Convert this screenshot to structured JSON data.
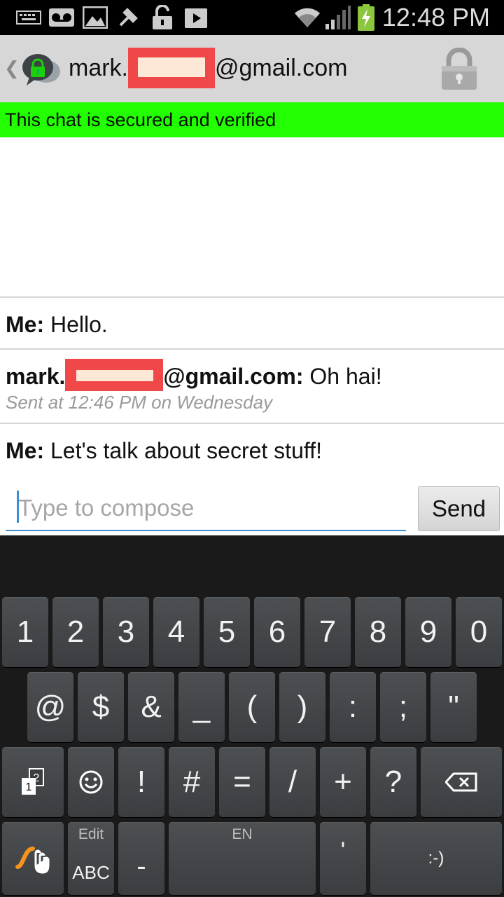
{
  "status_bar": {
    "time": "12:48 PM",
    "icons": [
      "keyboard-icon",
      "voicemail-icon",
      "image-icon",
      "tools-icon",
      "unlock-icon",
      "play-store-icon",
      "wifi-icon",
      "signal-icon",
      "battery-charging-icon"
    ]
  },
  "action_bar": {
    "title_prefix": "mark.",
    "title_suffix": "@gmail.com",
    "back_glyph": "❮",
    "app_icon": "secure-chat-icon",
    "lock_icon": "lock-icon"
  },
  "banner": {
    "text": "This chat is secured and verified",
    "color": "#21ff00"
  },
  "messages": [
    {
      "sender": "Me:",
      "text": "Hello."
    },
    {
      "sender_prefix": "mark.",
      "sender_suffix": "@gmail.com:",
      "text": "Oh hai!",
      "meta": "Sent at 12:46 PM on Wednesday"
    },
    {
      "sender": "Me:",
      "text": "Let's talk about secret stuff!"
    }
  ],
  "compose": {
    "placeholder": "Type to compose",
    "send_label": "Send"
  },
  "keyboard": {
    "row1": [
      "1",
      "2",
      "3",
      "4",
      "5",
      "6",
      "7",
      "8",
      "9",
      "0"
    ],
    "row2": [
      "@",
      "$",
      "&",
      "_",
      "(",
      ")",
      ":",
      ";",
      "\""
    ],
    "row3": [
      "!",
      "#",
      "=",
      "/",
      "+",
      "?"
    ],
    "edit_label": "Edit",
    "abc_label": "ABC",
    "dash_label": "-",
    "space_label": "EN",
    "apostrophe_label": "'",
    "smiley_label": ":-)"
  }
}
